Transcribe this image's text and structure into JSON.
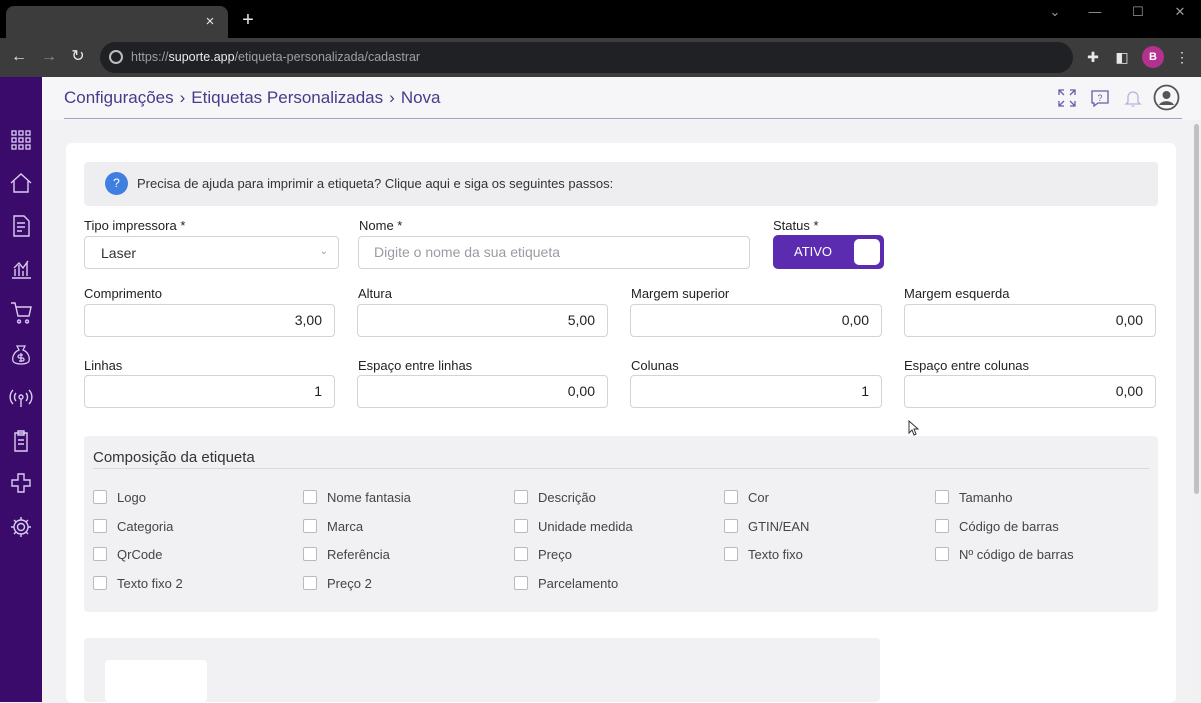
{
  "browser": {
    "new_tab": "+",
    "tab_close": "×",
    "url_host": "suporte.app",
    "url_prefix": "https://",
    "url_path": "/etiqueta-personalizada/cadastrar",
    "profile_initial": "B"
  },
  "breadcrumb": {
    "items": [
      "Configurações",
      "Etiquetas Personalizadas",
      "Nova"
    ],
    "separator": "›"
  },
  "help": {
    "icon": "?",
    "text": "Precisa de ajuda para imprimir a etiqueta? Clique aqui e siga os seguintes passos:"
  },
  "form": {
    "tipo_impressora": {
      "label": "Tipo impressora *",
      "value": "Laser"
    },
    "nome": {
      "label": "Nome *",
      "placeholder": "Digite o nome da sua etiqueta"
    },
    "status": {
      "label": "Status *",
      "value": "ATIVO"
    },
    "comprimento": {
      "label": "Comprimento",
      "value": "3,00"
    },
    "altura": {
      "label": "Altura",
      "value": "5,00"
    },
    "margem_superior": {
      "label": "Margem superior",
      "value": "0,00"
    },
    "margem_esquerda": {
      "label": "Margem esquerda",
      "value": "0,00"
    },
    "linhas": {
      "label": "Linhas",
      "value": "1"
    },
    "espaco_linhas": {
      "label": "Espaço entre linhas",
      "value": "0,00"
    },
    "colunas": {
      "label": "Colunas",
      "value": "1"
    },
    "espaco_colunas": {
      "label": "Espaço entre colunas",
      "value": "0,00"
    }
  },
  "composicao": {
    "title": "Composição da etiqueta",
    "items": [
      "Logo",
      "Nome fantasia",
      "Descrição",
      "Cor",
      "Tamanho",
      "Categoria",
      "Marca",
      "Unidade medida",
      "GTIN/EAN",
      "Código de barras",
      "QrCode",
      "Referência",
      "Preço",
      "Texto fixo",
      "Nº código de barras",
      "Texto fixo 2",
      "Preço 2",
      "Parcelamento"
    ]
  },
  "colors": {
    "sidebar": "#3b0b6b",
    "accent": "#5b2bb0",
    "breadcrumb": "#4a3a8a",
    "help_icon": "#3f7fe0"
  }
}
